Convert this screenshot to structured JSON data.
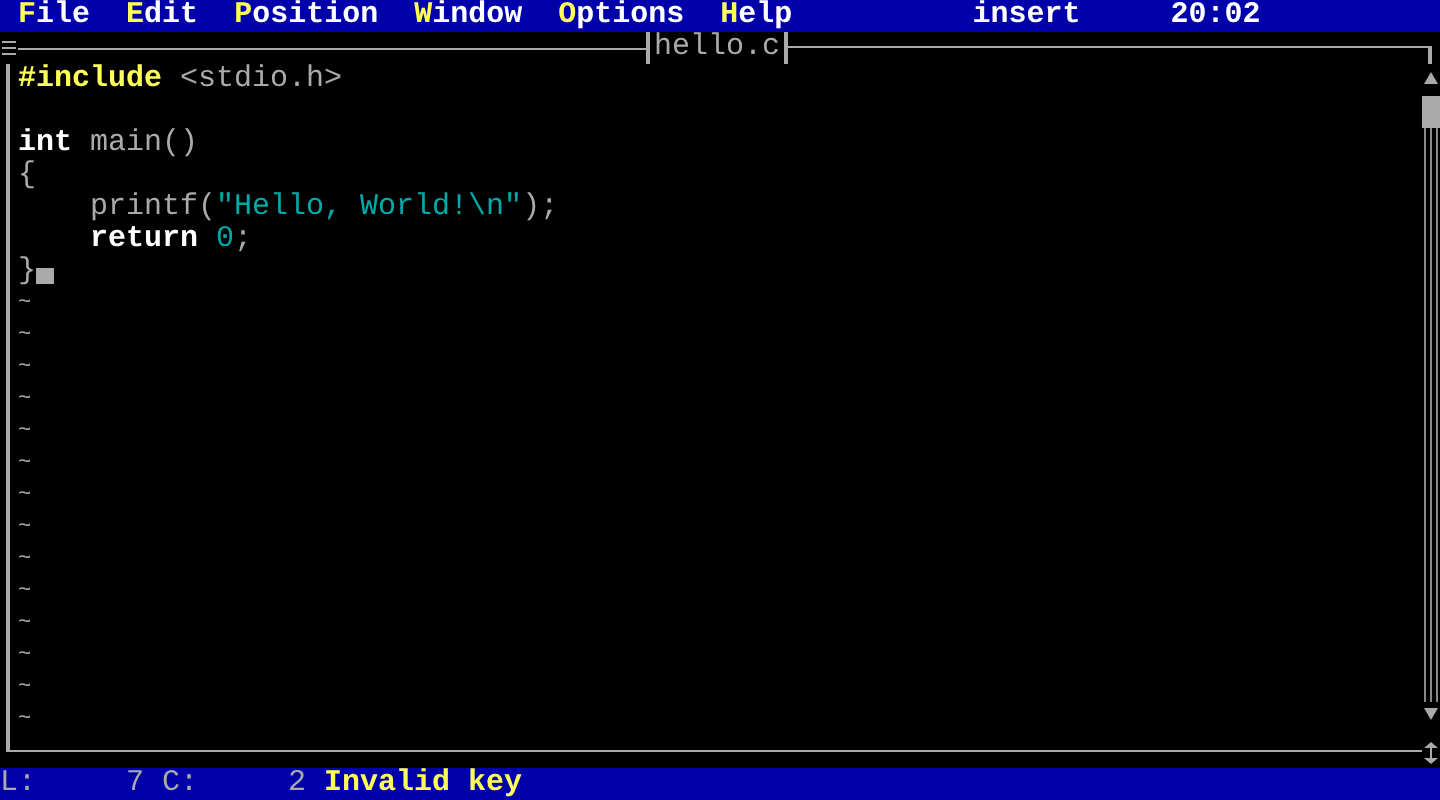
{
  "menu_bar": {
    "items": [
      {
        "hotkey": "F",
        "rest": "ile"
      },
      {
        "hotkey": "E",
        "rest": "dit"
      },
      {
        "hotkey": "P",
        "rest": "osition"
      },
      {
        "hotkey": "W",
        "rest": "indow"
      },
      {
        "hotkey": "O",
        "rest": "ptions"
      },
      {
        "hotkey": "H",
        "rest": "elp"
      }
    ],
    "mode": "insert",
    "clock": "20:02"
  },
  "window": {
    "title": "hello.c"
  },
  "editor": {
    "lines": [
      {
        "cursor": false,
        "tokens": [
          {
            "text": "#include",
            "kind": "directive"
          },
          {
            "text": " <stdio.h>",
            "kind": "plain"
          }
        ]
      },
      {
        "cursor": false
      },
      {
        "cursor": false,
        "tokens": [
          {
            "text": "int",
            "kind": "keyword"
          },
          {
            "text": " main()",
            "kind": "plain"
          }
        ]
      },
      {
        "cursor": false,
        "tokens": [
          {
            "text": "{",
            "kind": "plain"
          }
        ]
      },
      {
        "cursor": false,
        "tokens": [
          {
            "text": "    printf(",
            "kind": "plain"
          },
          {
            "text": "\"Hello, World!\\n\"",
            "kind": "string"
          },
          {
            "text": ");",
            "kind": "plain"
          }
        ]
      },
      {
        "cursor": false,
        "tokens": [
          {
            "text": "    return ",
            "kind": "keyword"
          },
          {
            "text": "0",
            "kind": "number"
          },
          {
            "text": ";",
            "kind": "plain"
          }
        ]
      },
      {
        "cursor": true,
        "tokens": [
          {
            "text": "}",
            "kind": "plain"
          }
        ]
      }
    ],
    "empty_line_markers": [
      "~",
      "~",
      "~",
      "~",
      "~",
      "~",
      "~",
      "~",
      "~",
      "~",
      "~",
      "~",
      "~",
      "~"
    ]
  },
  "status_bar": {
    "line_label": "L:",
    "line": "7",
    "column_label": "C:",
    "column": "2",
    "message": "Invalid key"
  }
}
